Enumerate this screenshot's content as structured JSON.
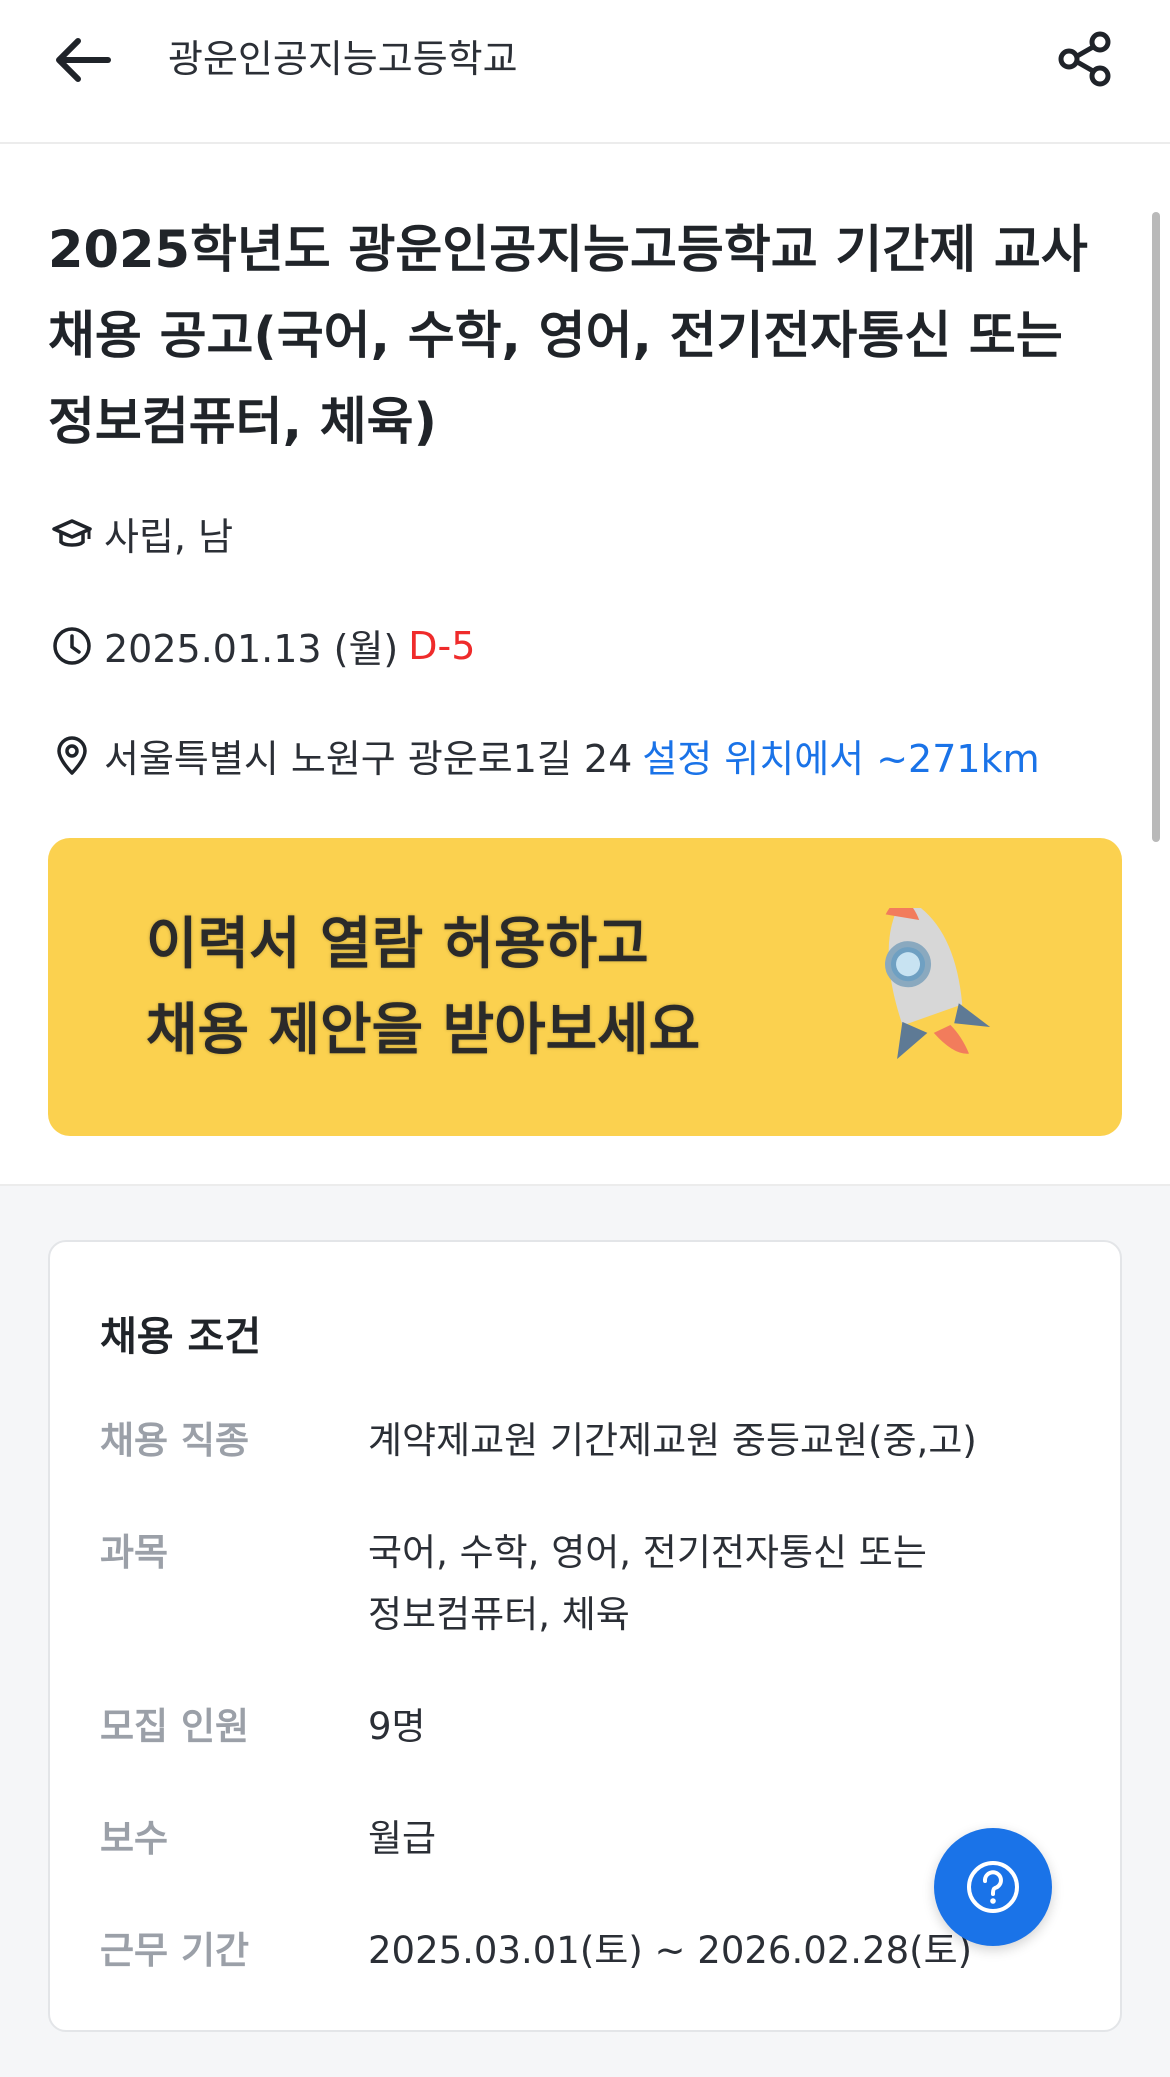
{
  "header": {
    "title": "광운인공지능고등학교"
  },
  "job": {
    "title": "2025학년도 광운인공지능고등학교 기간제 교사 채용 공고(국어, 수학, 영어, 전기전자통신 또는 정보컴퓨터, 체육)",
    "school_type": "사립, 남",
    "date": "2025.01.13 (월)",
    "dday": "D-5",
    "address": "서울특별시 노원구 광운로1길 24",
    "distance": "설정 위치에서 ~271km"
  },
  "banner": {
    "line1": "이력서 열람 허용하고",
    "line2": "채용 제안을 받아보세요"
  },
  "conditions": {
    "title": "채용 조건",
    "rows": [
      {
        "label": "채용 직종",
        "value": "계약제교원 기간제교원  중등교원(중,고)"
      },
      {
        "label": "과목",
        "value": "국어, 수학, 영어, 전기전자통신 또는 정보컴퓨터, 체육"
      },
      {
        "label": "모집 인원",
        "value": "9명"
      },
      {
        "label": "보수",
        "value": "월급"
      },
      {
        "label": "근무 기간",
        "value": "2025.03.01(토) ~ 2026.02.28(토)"
      }
    ]
  },
  "colors": {
    "accent": "#1a73e8",
    "dday": "#ef2b2b",
    "banner": "#fbd14f"
  },
  "icons": [
    "back-arrow-icon",
    "share-icon",
    "graduation-cap-icon",
    "clock-icon",
    "location-pin-icon",
    "rocket-icon",
    "help-icon"
  ]
}
